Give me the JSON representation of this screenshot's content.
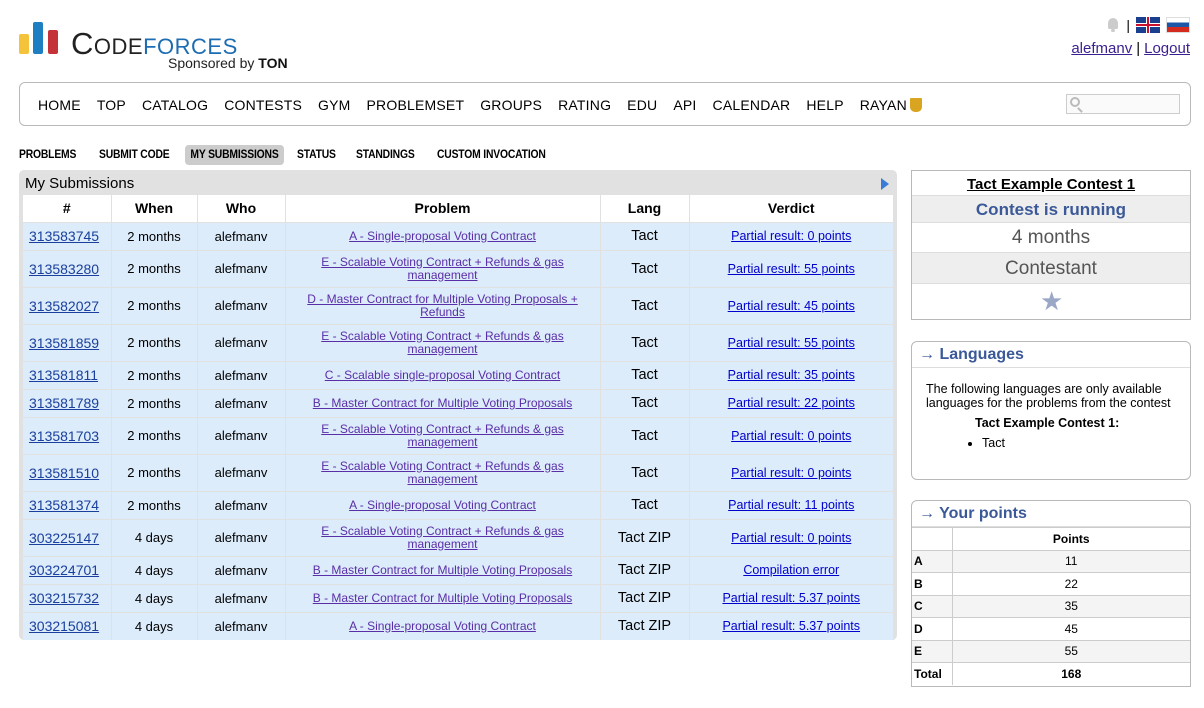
{
  "header": {
    "logo_left": "Code",
    "logo_right": "forces",
    "sponsor_prefix": "Sponsored by",
    "sponsor_name": "TON",
    "separator": "|",
    "user": "alefmanv",
    "logout": "Logout"
  },
  "nav": [
    "HOME",
    "TOP",
    "CATALOG",
    "CONTESTS",
    "GYM",
    "PROBLEMSET",
    "GROUPS",
    "RATING",
    "EDU",
    "API",
    "CALENDAR",
    "HELP",
    "RAYAN"
  ],
  "second_menu": [
    "PROBLEMS",
    "SUBMIT CODE",
    "MY SUBMISSIONS",
    "STATUS",
    "STANDINGS",
    "CUSTOM INVOCATION"
  ],
  "submissions": {
    "title": "My Submissions",
    "columns": [
      "#",
      "When",
      "Who",
      "Problem",
      "Lang",
      "Verdict"
    ],
    "rows": [
      {
        "id": "313583745",
        "when": "2 months",
        "who": "alefmanv",
        "problem": "A - Single-proposal Voting Contract",
        "lang": "Tact",
        "verdict": "Partial result: 0 points",
        "tall": false
      },
      {
        "id": "313583280",
        "when": "2 months",
        "who": "alefmanv",
        "problem": "E - Scalable Voting Contract + Refunds & gas management",
        "lang": "Tact",
        "verdict": "Partial result: 55 points",
        "tall": true
      },
      {
        "id": "313582027",
        "when": "2 months",
        "who": "alefmanv",
        "problem": "D - Master Contract for Multiple Voting Proposals + Refunds",
        "lang": "Tact",
        "verdict": "Partial result: 45 points",
        "tall": true
      },
      {
        "id": "313581859",
        "when": "2 months",
        "who": "alefmanv",
        "problem": "E - Scalable Voting Contract + Refunds & gas management",
        "lang": "Tact",
        "verdict": "Partial result: 55 points",
        "tall": true
      },
      {
        "id": "313581811",
        "when": "2 months",
        "who": "alefmanv",
        "problem": "C - Scalable single-proposal Voting Contract",
        "lang": "Tact",
        "verdict": "Partial result: 35 points",
        "tall": false
      },
      {
        "id": "313581789",
        "when": "2 months",
        "who": "alefmanv",
        "problem": "B - Master Contract for Multiple Voting Proposals",
        "lang": "Tact",
        "verdict": "Partial result: 22 points",
        "tall": false
      },
      {
        "id": "313581703",
        "when": "2 months",
        "who": "alefmanv",
        "problem": "E - Scalable Voting Contract + Refunds & gas management",
        "lang": "Tact",
        "verdict": "Partial result: 0 points",
        "tall": true
      },
      {
        "id": "313581510",
        "when": "2 months",
        "who": "alefmanv",
        "problem": "E - Scalable Voting Contract + Refunds & gas management",
        "lang": "Tact",
        "verdict": "Partial result: 0 points",
        "tall": true
      },
      {
        "id": "313581374",
        "when": "2 months",
        "who": "alefmanv",
        "problem": "A - Single-proposal Voting Contract",
        "lang": "Tact",
        "verdict": "Partial result: 11 points",
        "tall": false
      },
      {
        "id": "303225147",
        "when": "4 days",
        "who": "alefmanv",
        "problem": "E - Scalable Voting Contract + Refunds & gas management",
        "lang": "Tact ZIP",
        "verdict": "Partial result: 0 points",
        "tall": true
      },
      {
        "id": "303224701",
        "when": "4 days",
        "who": "alefmanv",
        "problem": "B - Master Contract for Multiple Voting Proposals",
        "lang": "Tact ZIP",
        "verdict": "Compilation error",
        "tall": false
      },
      {
        "id": "303215732",
        "when": "4 days",
        "who": "alefmanv",
        "problem": "B - Master Contract for Multiple Voting Proposals",
        "lang": "Tact ZIP",
        "verdict": "Partial result: 5.37 points",
        "tall": false
      },
      {
        "id": "303215081",
        "when": "4 days",
        "who": "alefmanv",
        "problem": "A - Single-proposal Voting Contract",
        "lang": "Tact ZIP",
        "verdict": "Partial result: 5.37 points",
        "tall": false
      }
    ]
  },
  "contest": {
    "name": "Tact Example Contest 1",
    "status": "Contest is running",
    "time": "4 months",
    "role": "Contestant"
  },
  "languages": {
    "title": "→ Languages",
    "text": "The following languages are only available languages for the problems from the contest",
    "contest_label": "Tact Example Contest 1:",
    "items": [
      "Tact"
    ]
  },
  "points": {
    "title": "→ Your points",
    "header": "Points",
    "rows": [
      {
        "label": "A",
        "value": "11"
      },
      {
        "label": "B",
        "value": "22"
      },
      {
        "label": "C",
        "value": "35"
      },
      {
        "label": "D",
        "value": "45"
      },
      {
        "label": "E",
        "value": "55"
      }
    ],
    "total_label": "Total",
    "total_value": "168"
  }
}
